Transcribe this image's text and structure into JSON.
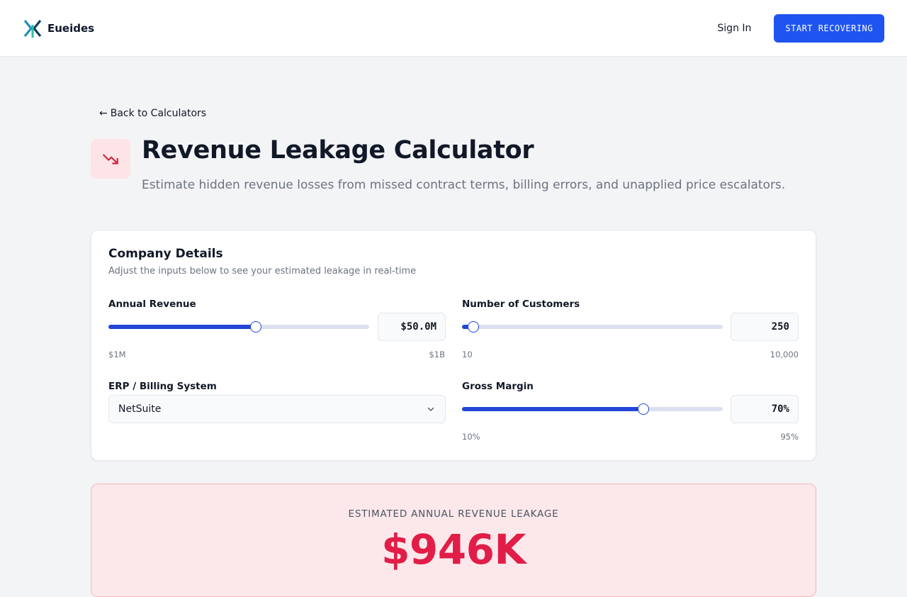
{
  "nav": {
    "brand_name": "Eueides",
    "sign_in": "Sign In",
    "cta_label": "START RECOVERING"
  },
  "header": {
    "back_link": "Back to Calculators",
    "back_arrow": "←",
    "title": "Revenue Leakage Calculator",
    "subtitle": "Estimate hidden revenue losses from missed contract terms, billing errors, and unapplied price escalators.",
    "icon": "trending-down-icon",
    "icon_color": "#d0243c"
  },
  "company_details": {
    "title": "Company Details",
    "description": "Adjust the inputs below to see your estimated leakage in real-time",
    "annual_revenue": {
      "label": "Annual Revenue",
      "value": "$50.0M",
      "min": "$1M",
      "max": "$1B",
      "level": 0.565
    },
    "customers": {
      "label": "Number of Customers",
      "value": "250",
      "min": "10",
      "max": "10,000",
      "level": 0.043
    },
    "erp": {
      "label": "ERP / Billing System",
      "selected": "NetSuite",
      "icon": "chevron-down-icon"
    },
    "gross_margin": {
      "label": "Gross Margin",
      "value": "70%",
      "min": "10%",
      "max": "95%",
      "level": 0.697
    }
  },
  "result": {
    "label": "ESTIMATED ANNUAL REVENUE LEAKAGE",
    "value": "$946K"
  },
  "colors": {
    "accent": "#1f54f0",
    "slider": "#2246d8",
    "leak_red": "#e11d48",
    "result_bg": "#fce8ea"
  }
}
